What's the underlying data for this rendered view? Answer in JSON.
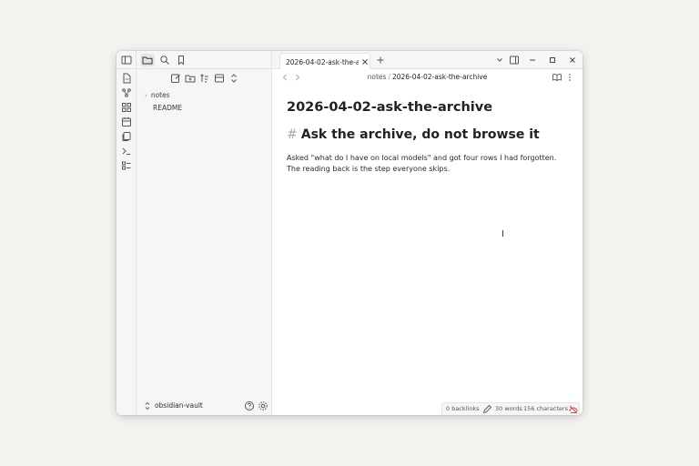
{
  "ribbon": {
    "toggle_icon": "sidebar-toggle-icon",
    "items": [
      {
        "icon": "file-icon",
        "label": "Open quick switcher"
      },
      {
        "icon": "graph-icon",
        "label": "Open graph view"
      },
      {
        "icon": "canvas-icon",
        "label": "Create new canvas"
      },
      {
        "icon": "calendar-icon",
        "label": "Open today's daily note"
      },
      {
        "icon": "templates-icon",
        "label": "Insert template"
      },
      {
        "icon": "terminal-icon",
        "label": "Open command palette"
      },
      {
        "icon": "bases-icon",
        "label": "Create new base"
      }
    ]
  },
  "sidebar": {
    "top_tabs": [
      "folder-icon",
      "search-icon",
      "bookmark-icon"
    ],
    "toolbar": [
      "new-note-icon",
      "new-folder-icon",
      "sort-icon",
      "collapse-icon",
      "expand-icon"
    ],
    "tree": [
      {
        "type": "folder",
        "label": "notes"
      },
      {
        "type": "file",
        "label": "README"
      }
    ],
    "vault_name": "obsidian-vault"
  },
  "tabbar": {
    "active_tab": "2026-04-02-ask-the-ar..."
  },
  "breadcrumb": {
    "folder": "notes",
    "separator": "/",
    "file": "2026-04-02-ask-the-archive"
  },
  "document": {
    "title": "2026-04-02-ask-the-archive",
    "heading_marker": "#",
    "heading": "Ask the archive, do not browse it",
    "paragraph": "Asked \"what do I have on local models\" and got four rows I had forgotten. The reading back is the step everyone skips."
  },
  "status": {
    "backlinks": "0 backlinks",
    "words": "30 words",
    "characters": "156 characters"
  },
  "colors": {
    "background": "#f3f2ef",
    "pane": "#f6f6f6",
    "text": "#222222",
    "sync_error": "#e03e3e"
  }
}
